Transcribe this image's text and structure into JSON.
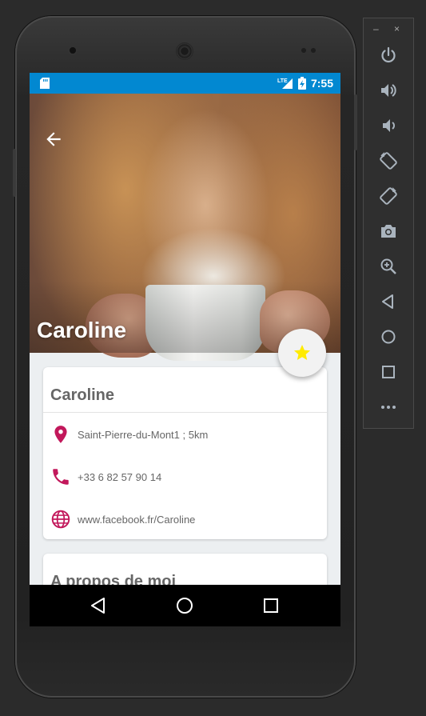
{
  "status_bar": {
    "time": "7:55",
    "network": "LTE",
    "color": "#0288d1"
  },
  "hero": {
    "title": "Caroline"
  },
  "fab": {
    "icon": "star-icon",
    "icon_color": "#ffeb00"
  },
  "profile_card": {
    "title": "Caroline",
    "rows": [
      {
        "icon": "location-pin-icon",
        "text": "Saint-Pierre-du-Mont1 ; 5km"
      },
      {
        "icon": "phone-icon",
        "text": "+33 6 82 57 90 14"
      },
      {
        "icon": "globe-icon",
        "text": "www.facebook.fr/Caroline"
      }
    ]
  },
  "about_card": {
    "title": "A propos de moi"
  },
  "accent_color": "#c2185b",
  "emulator_toolbar": {
    "minimize_label": "–",
    "close_label": "×",
    "buttons": [
      "power-icon",
      "volume-up-icon",
      "volume-down-icon",
      "rotate-left-icon",
      "rotate-right-icon",
      "camera-icon",
      "zoom-icon",
      "back-icon",
      "home-icon",
      "overview-icon",
      "more-icon"
    ]
  }
}
